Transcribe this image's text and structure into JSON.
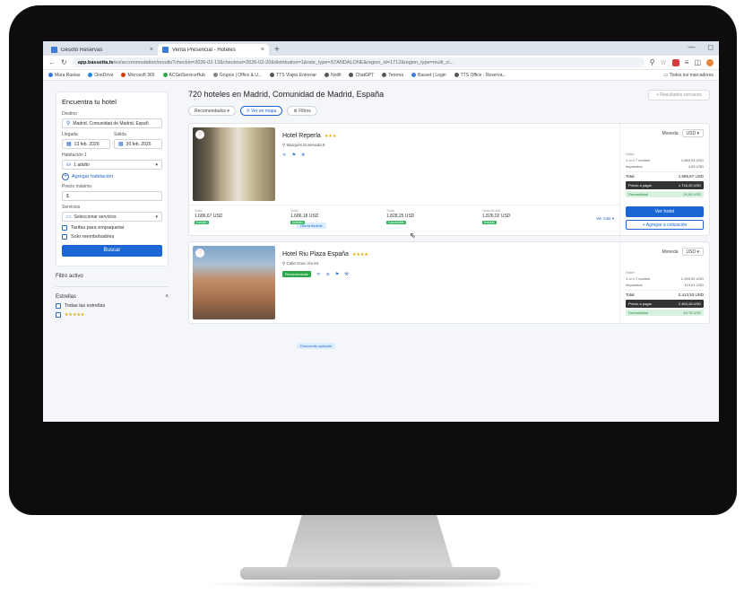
{
  "browser": {
    "tabs": [
      {
        "title": "Gesoto Reservas",
        "close": "×",
        "active": false
      },
      {
        "title": "Venta Presencial - Hoteles",
        "close": "×",
        "active": true
      }
    ],
    "new_tab": "+",
    "window_controls": [
      "—",
      "◻"
    ],
    "url_host": "app.bassetta.tv",
    "url_rest": "/es/accommodation/results?checkin=2026-02-13&checkout=2026-02-20&distribution=1&rate_type=STANDALONE&region_id=1712&region_type=multi_ci...",
    "bookmarks": [
      {
        "label": "Mara Ruelas",
        "color": "#3c7bd8"
      },
      {
        "label": "OneDrive",
        "color": "#1f8ae0"
      },
      {
        "label": "Microsoft 365",
        "color": "#d83b01"
      },
      {
        "label": "ACSetServiceHub",
        "color": "#2aa84a"
      },
      {
        "label": "Grupos | Office & U...",
        "color": "#888888"
      },
      {
        "label": "TTS Viajes Entrenar",
        "color": "#555555"
      },
      {
        "label": "Notifi",
        "color": "#555555"
      },
      {
        "label": "ChatGPT",
        "color": "#555555"
      },
      {
        "label": "Terema",
        "color": "#555555"
      },
      {
        "label": "Basset | Login",
        "color": "#3c7bd8"
      },
      {
        "label": "TTS Office - Reserva...",
        "color": "#555555"
      }
    ],
    "bookmarks_all": "Todos los marcadores"
  },
  "sidebar": {
    "title": "Encuentra tu hotel",
    "destination_label": "Destino",
    "destination_value": "Madrid, Comunidad de Madrid, Españ",
    "checkin_label": "Llegada",
    "checkin_value": "13 feb. 2026",
    "checkout_label": "Salida",
    "checkout_value": "20 feb. 2026",
    "room_label": "Habitación 1",
    "room_value": "1 adulto",
    "add_room": "Agregar habitación",
    "max_price_label": "Precio máximo",
    "max_price_value": "$",
    "services_label": "Servicios",
    "services_value": "Seleccionar servicios",
    "check_package": "Tarifas para empaquetar",
    "check_refundable": "Solo reembolsables",
    "search_button": "Buscar",
    "active_filters": "Filtro activo",
    "stars_section": "Estrellas",
    "stars_all": "Todas las estrellas",
    "stars_five": "★★★★★"
  },
  "main": {
    "results_title": "720 hoteles en Madrid, Comunidad de Madrid, España",
    "top_right_button": "+ Resultados cercanos",
    "sort_label": "Recomendados",
    "map_pill": "Ver en mapa",
    "filters_pill": "Filtros"
  },
  "hotels": [
    {
      "name": "Hotel Reperla",
      "stars": "★★★",
      "address": "Marqués Ensenada 9",
      "promo": "Oferta flexible",
      "rates": [
        {
          "label": "Tarifa",
          "value": "1.686,67 USD",
          "tag": "Incluido"
        },
        {
          "label": "Tarifa",
          "value": "1.686,18 USD",
          "tag": "Incluido"
        },
        {
          "label": "Tarifa",
          "value": "1.828,25 USD",
          "tag": "Cancelable"
        },
        {
          "label": "Tarifa flexible",
          "value": "1.826,02 USD",
          "tag": "Incluido"
        }
      ],
      "ver_mas": "Ver más",
      "currency_label": "Moneda",
      "currency_value": "USD",
      "price_section": "Hotel",
      "line1_label": "1 ⛀ x 7 noches",
      "line1_value": "1.682,04 USD",
      "line2_label": "Impuestos",
      "line2_value": "4,63 USD",
      "total_label": "Total",
      "total_value": "1.686,67 USD",
      "pay_label": "Precio a pagar",
      "pay_value": "1.716,26 USD",
      "earn_label": "Rentabilidad",
      "earn_value": "29,59 USD",
      "see_hotel": "Ver hotel",
      "add_quote": "+ Agregar a cotización"
    },
    {
      "name": "Hotel Riu Plaza España",
      "stars": "★★★★",
      "address": "Calle Gran Vía 84",
      "badge": "Recomendado",
      "promo": "Descuento aplicado",
      "currency_label": "Moneda",
      "currency_value": "USD",
      "price_section": "Hotel",
      "line1_label": "1 ⛀ x 7 noches",
      "line1_value": "2.293,92 USD",
      "line2_label": "Impuestos",
      "line2_value": "119,61 USD",
      "total_label": "Total",
      "total_value": "2.413,53 USD",
      "pay_label": "Precio a pagar",
      "pay_value": "2.463,28 USD",
      "earn_label": "Rentabilidad",
      "earn_value": "49,75 USD"
    }
  ]
}
